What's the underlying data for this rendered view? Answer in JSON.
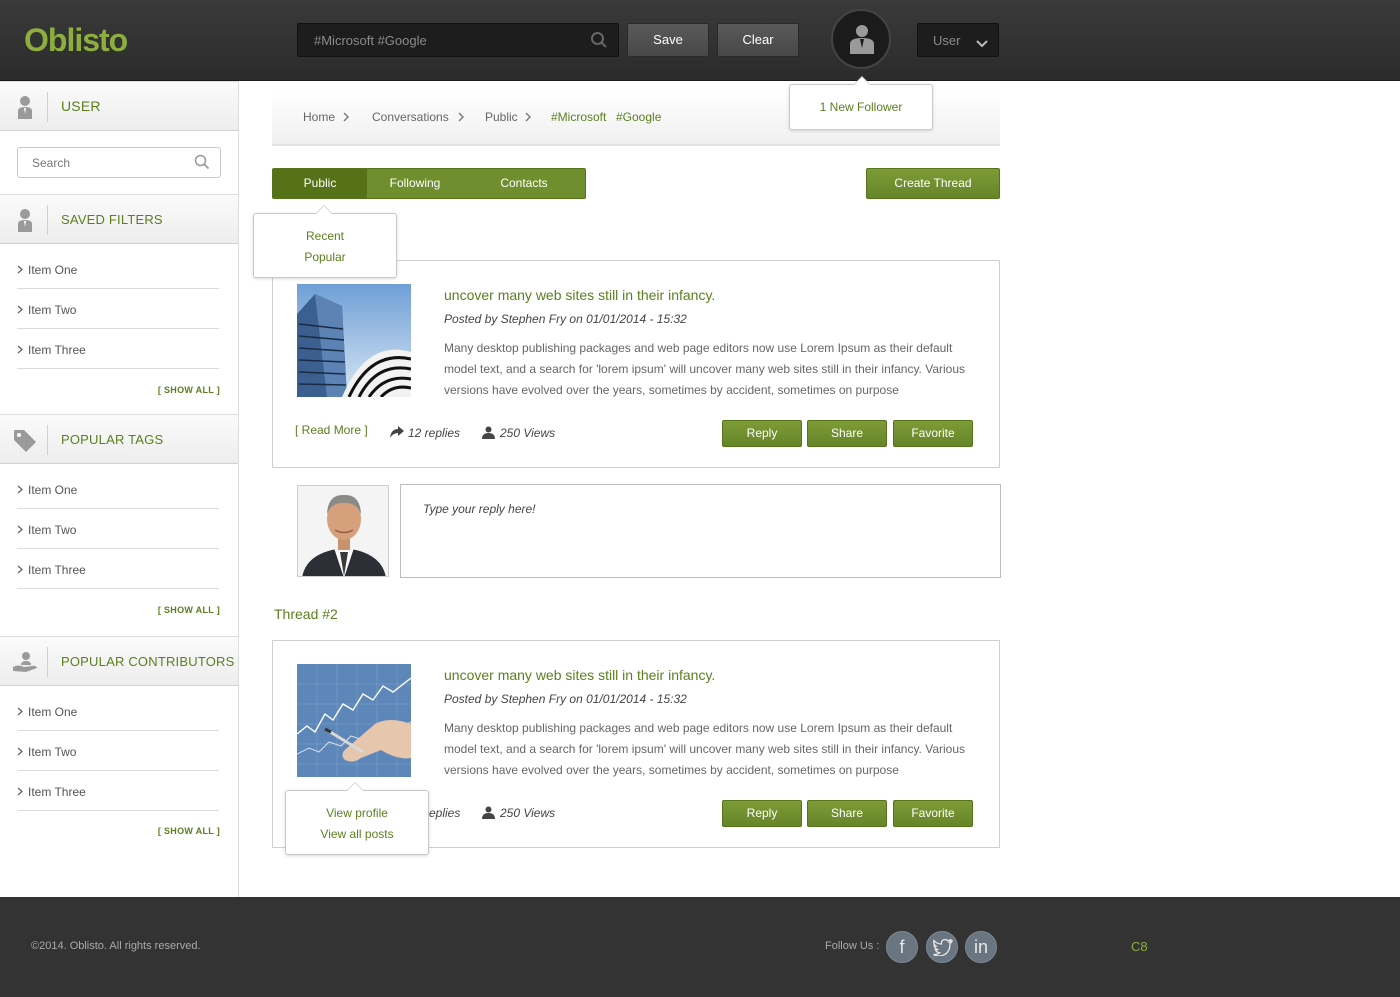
{
  "header": {
    "logo": "Oblisto",
    "search_value": "#Microsoft   #Google",
    "save_label": "Save",
    "clear_label": "Clear",
    "user_label": "User",
    "notification": "1 New Follower"
  },
  "sidebar": {
    "user_title": "USER",
    "search_placeholder": "Search",
    "saved_filters": {
      "title": "SAVED FILTERS",
      "items": [
        "Item One",
        "Item Two",
        "Item Three"
      ],
      "show_all": "[ SHOW ALL ]"
    },
    "popular_tags": {
      "title": "POPULAR TAGS",
      "items": [
        "Item One",
        "Item Two",
        "Item Three"
      ],
      "show_all": "[ SHOW ALL ]"
    },
    "popular_contributors": {
      "title": "POPULAR CONTRIBUTORS",
      "items": [
        "Item One",
        "Item Two",
        "Item Three"
      ],
      "show_all": "[ SHOW ALL ]"
    }
  },
  "breadcrumb": {
    "items": [
      "Home",
      "Conversations",
      "Public",
      "#Microsoft",
      "#Google"
    ]
  },
  "tabs": {
    "items": [
      "Public",
      "Following",
      "Contacts"
    ],
    "active": "Public",
    "dropdown": [
      "Recent",
      "Popular"
    ]
  },
  "create_thread_label": "Create Thread",
  "threads": [
    {
      "title": "uncover many web sites still in their infancy.",
      "meta": "Posted by Stephen Fry on 01/01/2014 - 15:32",
      "body": "Many desktop publishing packages and web page editors now use Lorem Ipsum as their default model text, and a search for 'lorem ipsum' will uncover many web sites still in their infancy. Various versions have evolved over the years, sometimes by accident, sometimes on purpose",
      "read_more": "[ Read More ]",
      "replies": "12 replies",
      "views": "250 Views",
      "reply_label": "Reply",
      "share_label": "Share",
      "favorite_label": "Favorite"
    },
    {
      "title": "uncover many web sites still in their infancy.",
      "meta": "Posted by Stephen Fry on 01/01/2014 - 15:32",
      "body": "Many desktop publishing packages and web page editors now use Lorem Ipsum as their default model text, and a search for 'lorem ipsum' will uncover many web sites still in their infancy. Various versions have evolved over the years, sometimes by accident, sometimes on purpose",
      "replies": "eplies",
      "views": "250 Views",
      "reply_label": "Reply",
      "share_label": "Share",
      "favorite_label": "Favorite"
    }
  ],
  "reply_placeholder": "Type your reply here!",
  "thread2_label": "Thread #2",
  "profile_menu": [
    "View profile",
    "View all posts"
  ],
  "footer": {
    "copyright": "©2014. Oblisto. All rights reserved.",
    "follow_us": "Follow Us :",
    "social": [
      "f",
      "t",
      "in"
    ],
    "code": "C8"
  },
  "colors": {
    "accent": "#5b7f1f",
    "button_green": "#6f8f2f",
    "header_bg": "#2e2e2e",
    "footer_bg": "#333333"
  }
}
